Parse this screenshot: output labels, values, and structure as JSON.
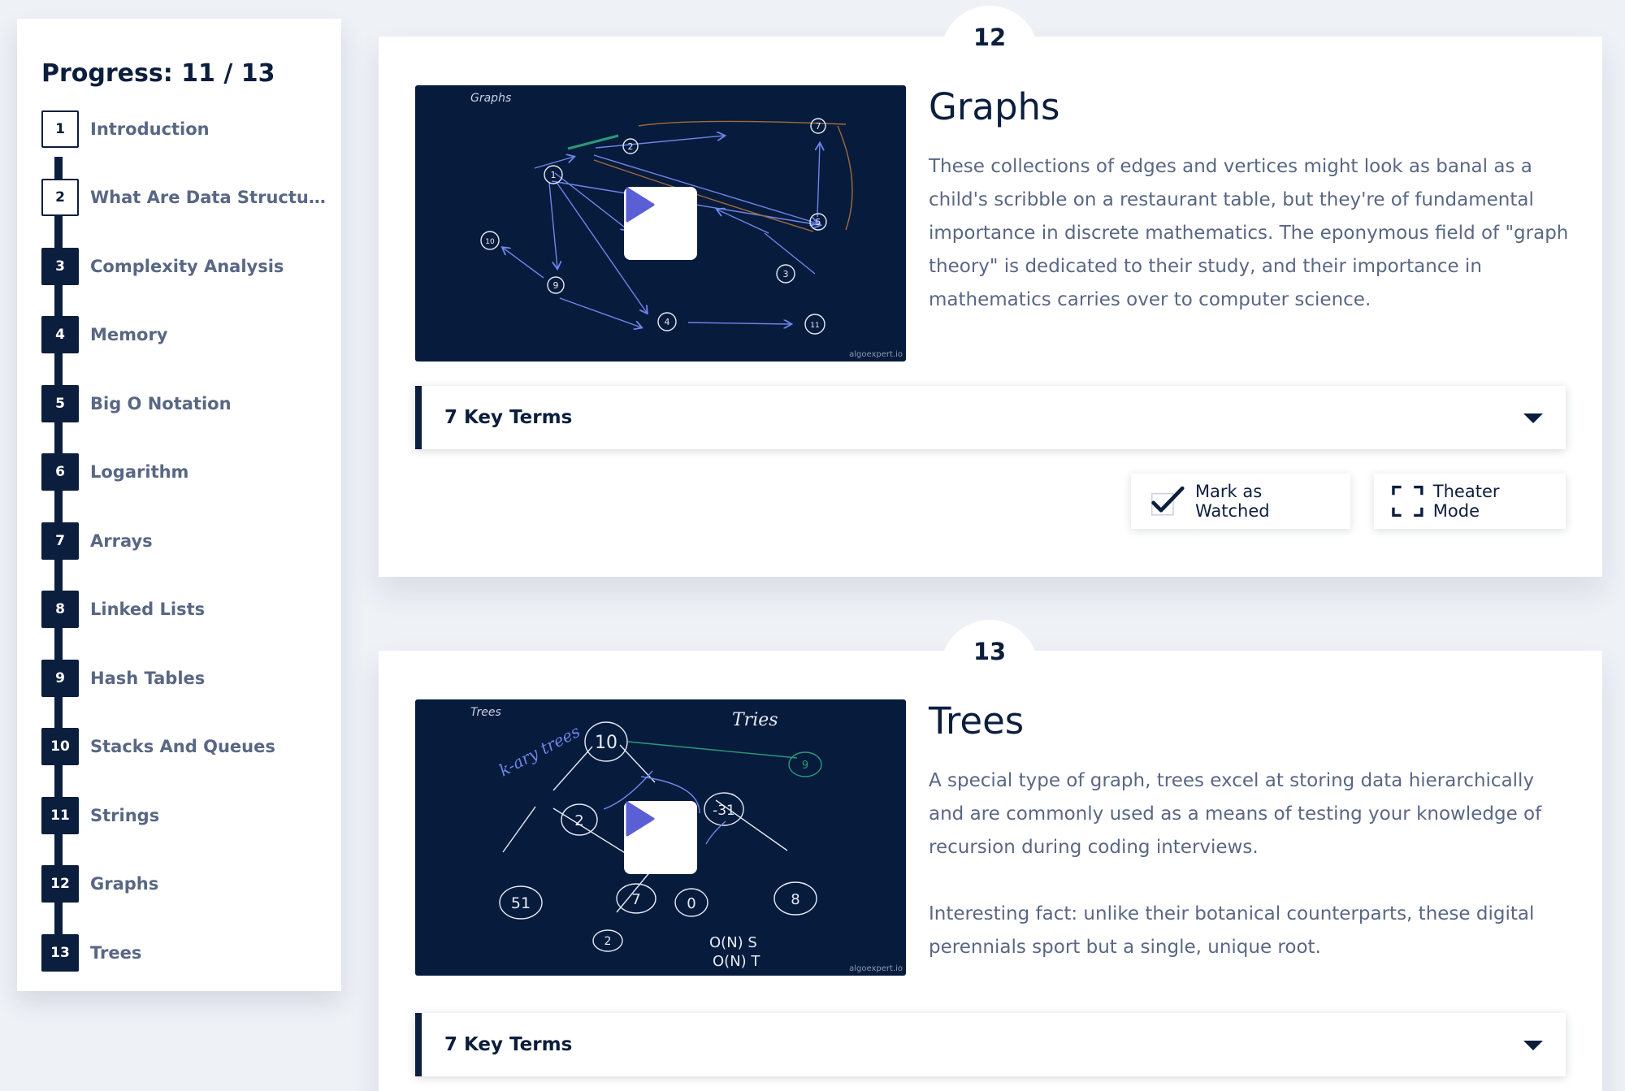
{
  "sidebar": {
    "progress_label": "Progress: 11 / 13",
    "steps": [
      {
        "num": "1",
        "label": "Introduction",
        "done": false
      },
      {
        "num": "2",
        "label": "What Are Data Structures?",
        "done": false
      },
      {
        "num": "3",
        "label": "Complexity Analysis",
        "done": true
      },
      {
        "num": "4",
        "label": "Memory",
        "done": true
      },
      {
        "num": "5",
        "label": "Big O Notation",
        "done": true
      },
      {
        "num": "6",
        "label": "Logarithm",
        "done": true
      },
      {
        "num": "7",
        "label": "Arrays",
        "done": true
      },
      {
        "num": "8",
        "label": "Linked Lists",
        "done": true
      },
      {
        "num": "9",
        "label": "Hash Tables",
        "done": true
      },
      {
        "num": "10",
        "label": "Stacks And Queues",
        "done": true
      },
      {
        "num": "11",
        "label": "Strings",
        "done": true
      },
      {
        "num": "12",
        "label": "Graphs",
        "done": true
      },
      {
        "num": "13",
        "label": "Trees",
        "done": true
      }
    ]
  },
  "cards": [
    {
      "number": "12",
      "title": "Graphs",
      "thumb_label": "Graphs",
      "thumb_credit": "algoexpert.io",
      "description": [
        "These collections of edges and vertices might look as banal as a child's scribble on a restaurant table, but they're of fundamental importance in discrete mathematics. The eponymous field of \"graph theory\" is dedicated to their study, and their importance in mathematics carries over to computer science."
      ],
      "key_terms_label": "7 Key Terms",
      "mark_watched_label": "Mark as Watched",
      "theater_mode_label": "Theater Mode"
    },
    {
      "number": "13",
      "title": "Trees",
      "thumb_label": "Trees",
      "thumb_credit": "algoexpert.io",
      "thumb_annotations": [
        "k-ary trees",
        "Tries",
        "O(N) S",
        "O(N) T"
      ],
      "tree_nodes": [
        "10",
        "2",
        "-31",
        "51",
        "7",
        "0",
        "8",
        "2",
        "9"
      ],
      "description": [
        "A special type of graph, trees excel at storing data hierarchically and are commonly used as a means of testing your knowledge of recursion during coding interviews.",
        "Interesting fact: unlike their botanical counterparts, these digital perennials sport but a single, unique root."
      ],
      "key_terms_label": "7 Key Terms"
    }
  ],
  "graph_nodes": [
    "1",
    "2",
    "7",
    "5",
    "10",
    "9",
    "4",
    "3",
    "11"
  ],
  "colors": {
    "navy": "#0c1e3d",
    "muted_text": "#596784",
    "play_icon": "#5b5fd6",
    "thumb_bg": "#071b3d"
  }
}
